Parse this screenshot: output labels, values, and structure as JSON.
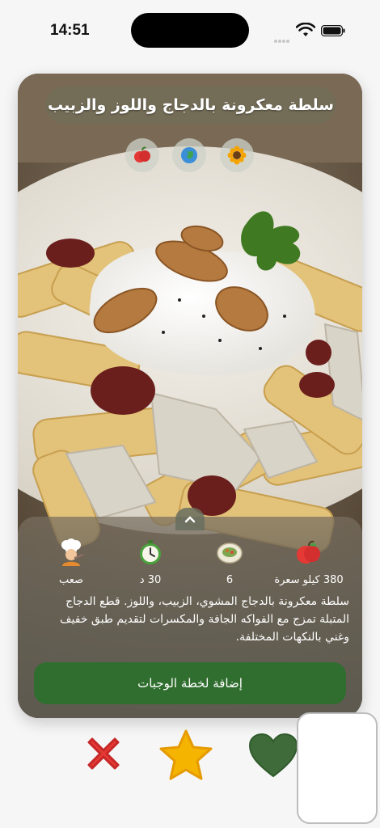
{
  "status_bar": {
    "time": "14:51"
  },
  "recipe": {
    "title": "سلطة معكرونة بالدجاج واللوز والزبيب",
    "tags": [
      "apple-tag-icon",
      "globe-tag-icon",
      "sunflower-tag-icon"
    ],
    "stats": [
      {
        "icon": "apple-icon",
        "label": "380 كيلو سعرة"
      },
      {
        "icon": "plate-icon",
        "label": "6"
      },
      {
        "icon": "timer-icon",
        "label": "30 د"
      },
      {
        "icon": "chef-icon",
        "label": "صعب"
      }
    ],
    "description": "سلطة معكرونة بالدجاج المشوي، الزبيب، واللوز. قطع الدجاج المتبلة تمزج مع الفواكه الجافة والمكسرات لتقديم طبق خفيف وغني بالنكهات المختلفة.",
    "add_button": "إضافة لخطة الوجبات"
  },
  "actions": {
    "dislike": "close-icon",
    "favorite": "star-icon",
    "like": "heart-icon"
  },
  "colors": {
    "add_button": "#2f6e2f",
    "dislike": "#e53935",
    "favorite": "#f5b400",
    "like": "#3f6b3a"
  }
}
